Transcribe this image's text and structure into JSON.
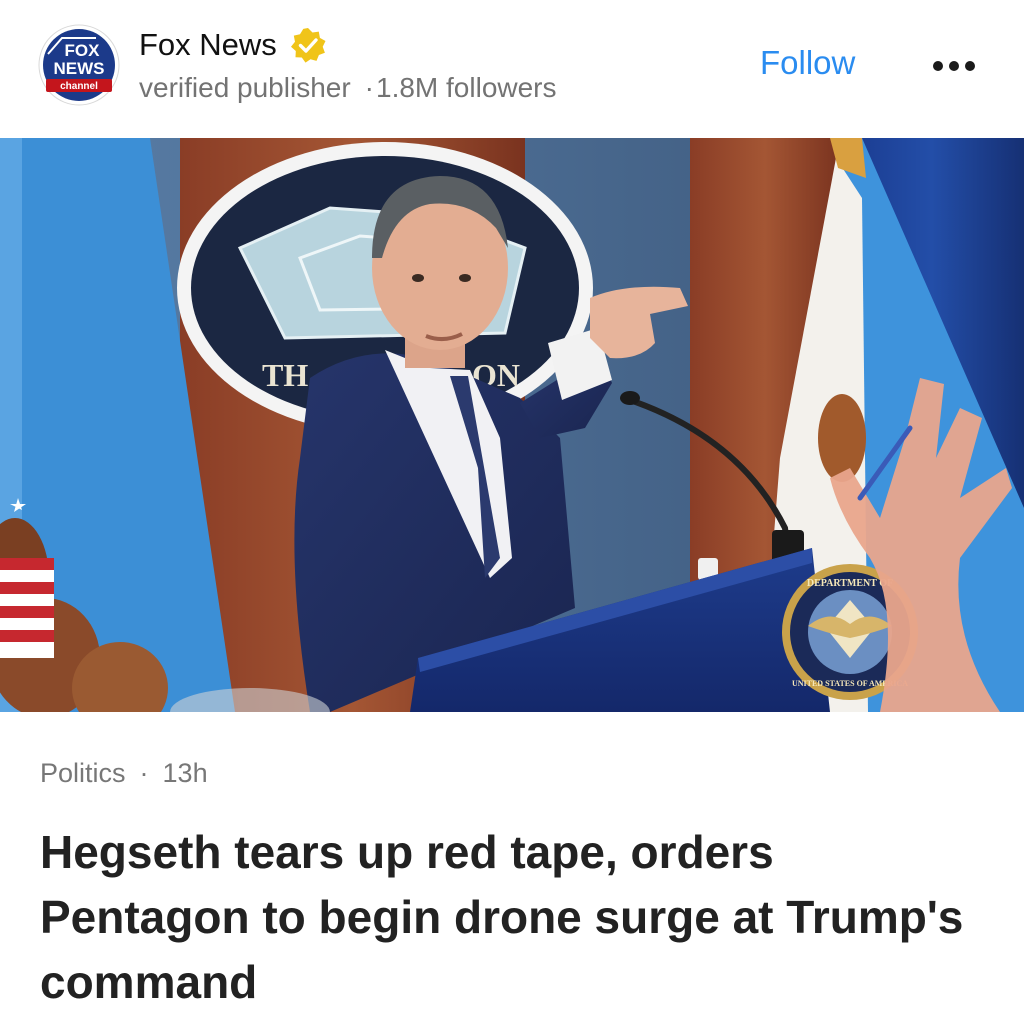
{
  "publisher": {
    "name": "Fox News",
    "logo_text": [
      "FOX",
      "NEWS",
      "channel"
    ],
    "subtitle": "verified publisher",
    "followers": "1.8M followers"
  },
  "actions": {
    "follow_label": "Follow",
    "more_icon": "ellipsis-horizontal-icon"
  },
  "hero_image": {
    "lettering": [
      "TH",
      "ON",
      "DEPARTMENT OF",
      "UNITED STATES OF AMERICA"
    ]
  },
  "article": {
    "category": "Politics",
    "age": "13h",
    "headline": "Hegseth tears up red tape, orders Pentagon to begin drone surge at Trump's command"
  },
  "colors": {
    "accent": "#2a8cf0",
    "verified_badge": "#f0c419",
    "logo_blue": "#1c3a8a",
    "logo_red": "#c4151c"
  }
}
